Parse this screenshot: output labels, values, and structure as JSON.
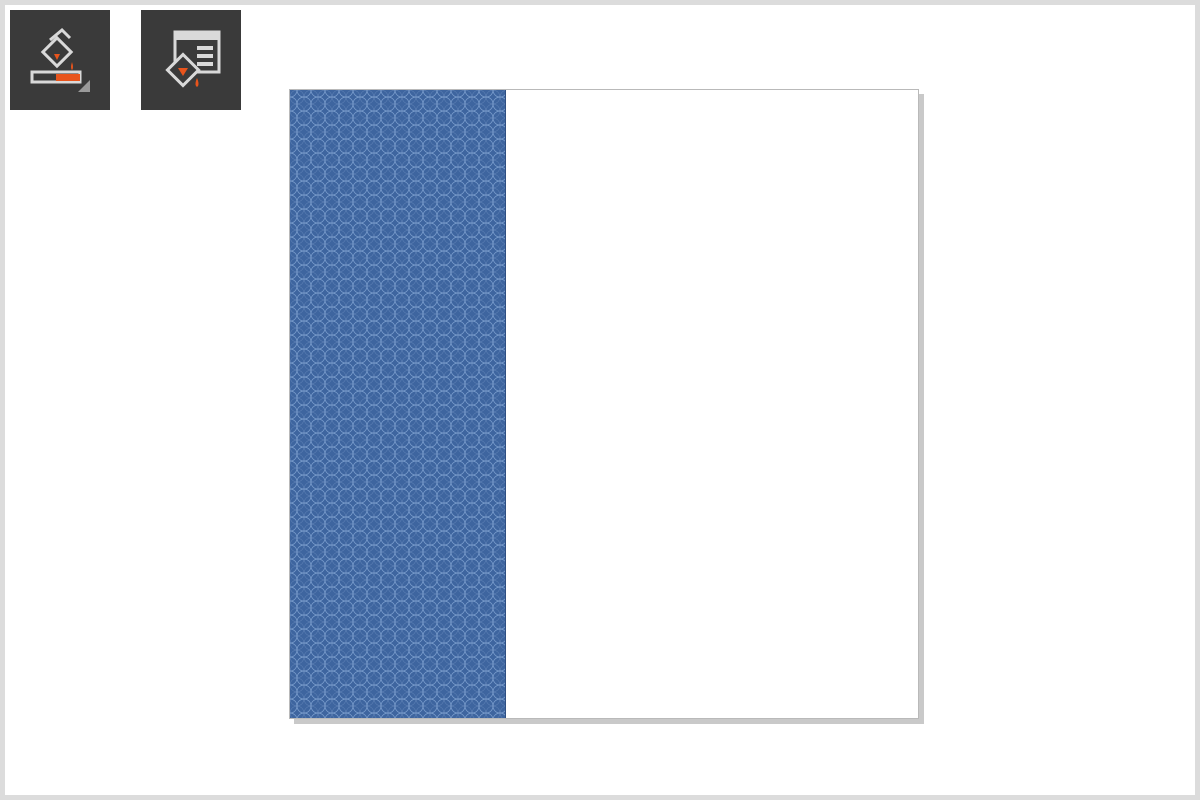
{
  "toolbar": {
    "buttons": [
      {
        "icon": "interactive-fill-tool-icon"
      },
      {
        "icon": "fill-properties-icon"
      }
    ],
    "accent_color": "#e8541c",
    "icon_color": "#d9d9d9",
    "background_color": "#3a3a3a"
  },
  "document": {
    "page_color": "#ffffff",
    "pattern_fill": {
      "base_color": "#3e659f",
      "line_color": "#8fb0dc"
    }
  }
}
